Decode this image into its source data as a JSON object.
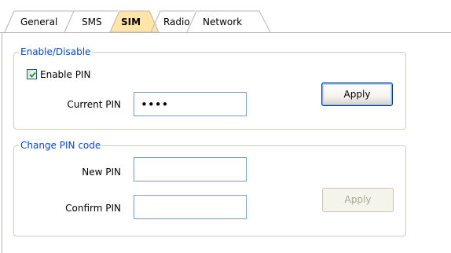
{
  "tabs": [
    {
      "label": "General",
      "active": false
    },
    {
      "label": "SMS",
      "active": false
    },
    {
      "label": "SIM",
      "active": true
    },
    {
      "label": "Radio",
      "active": false
    },
    {
      "label": "Network",
      "active": false
    }
  ],
  "enable_group": {
    "title": "Enable/Disable",
    "enable_pin_label": "Enable PIN",
    "enable_pin_checked": true,
    "current_pin_label": "Current PIN",
    "current_pin_value": "••••",
    "apply_label": "Apply"
  },
  "change_group": {
    "title": "Change PIN code",
    "new_pin_label": "New PIN",
    "new_pin_value": "",
    "confirm_pin_label": "Confirm PIN",
    "confirm_pin_value": "",
    "apply_label": "Apply",
    "apply_enabled": false
  },
  "colors": {
    "group_title": "#0046d5",
    "active_tab": "#ffe6a8",
    "border": "#d0d0bf",
    "textbox_border": "#7f9db9"
  }
}
